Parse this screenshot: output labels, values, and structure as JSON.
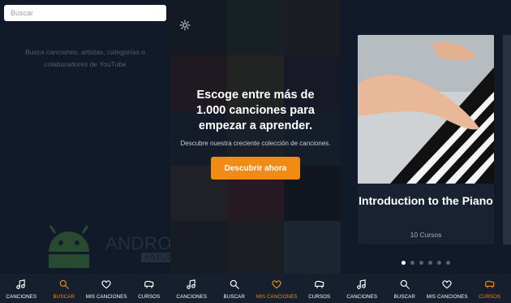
{
  "search": {
    "placeholder": "Buscar"
  },
  "left_hint": "Busca canciones, artistas, categorías o colaboradores de YouTube",
  "watermark": {
    "text": "ANDROID",
    "sub": "+AYUDA"
  },
  "middle": {
    "title": "Escoge entre más de 1.000 canciones para empezar a aprender.",
    "subtitle": "Descubre nuestra creciente colección de canciones.",
    "cta_label": "Descubrir ahora"
  },
  "course_card": {
    "title": "Introduction to the Piano",
    "count": "10 Cursos"
  },
  "carousel": {
    "pages": 6,
    "active": 0
  },
  "nav": {
    "screens": [
      {
        "items": [
          "CANCIONES",
          "BUSCAR",
          "MIS CANCIONES",
          "CURSOS"
        ],
        "active": 1
      },
      {
        "items": [
          "CANCIONES",
          "BUSCAR",
          "MIS CANCIONES",
          "CURSOS"
        ],
        "active": 2
      },
      {
        "items": [
          "CANCIONES",
          "BUSCAR",
          "MIS CANCIONES",
          "CURSOS"
        ],
        "active": 3
      }
    ],
    "icons": [
      "music-note-icon",
      "search-icon",
      "heart-icon",
      "piano-icon"
    ]
  },
  "colors": {
    "accent": "#f28a14",
    "background": "#111a29",
    "nav_background": "#161f2e"
  }
}
